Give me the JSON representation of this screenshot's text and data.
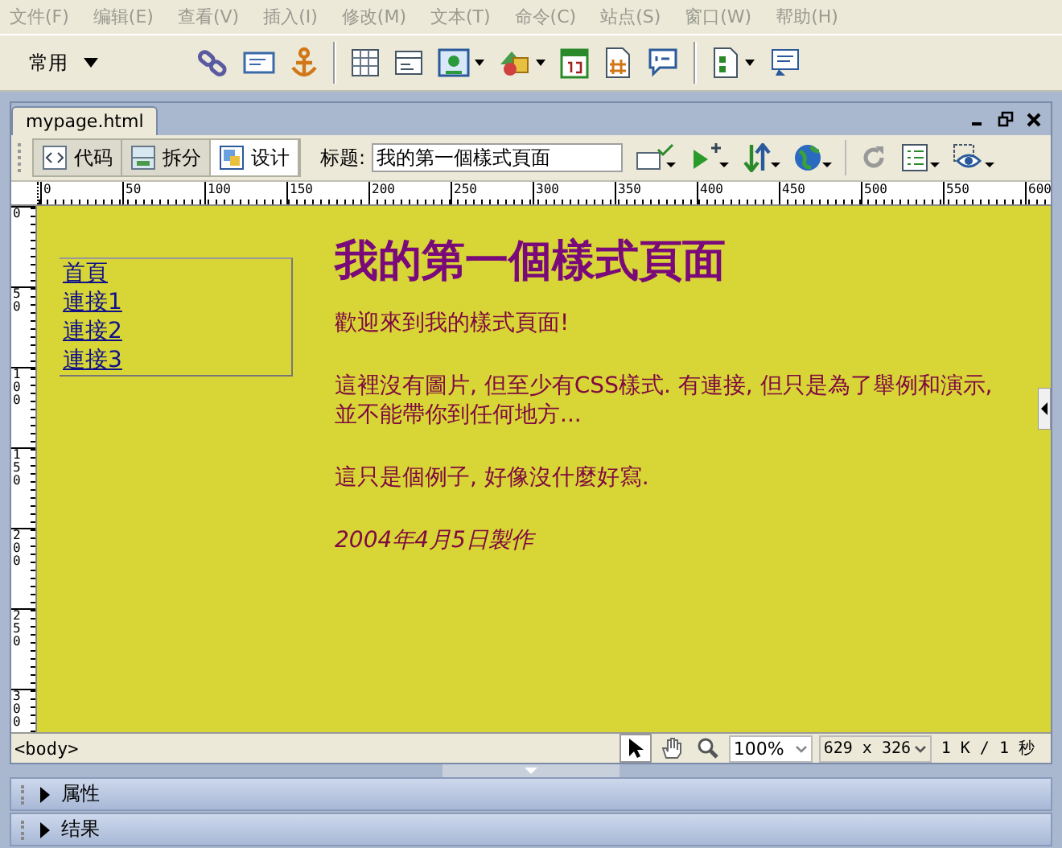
{
  "menu": [
    {
      "label": "文件(F)",
      "disabled": true
    },
    {
      "label": "编辑(E)",
      "disabled": true
    },
    {
      "label": "查看(V)",
      "disabled": true
    },
    {
      "label": "插入(I)",
      "disabled": true
    },
    {
      "label": "修改(M)",
      "disabled": true
    },
    {
      "label": "文本(T)",
      "disabled": true
    },
    {
      "label": "命令(C)",
      "disabled": true
    },
    {
      "label": "站点(S)",
      "disabled": true
    },
    {
      "label": "窗口(W)",
      "disabled": true
    },
    {
      "label": "帮助(H)",
      "disabled": true
    }
  ],
  "insert_bar": {
    "category": "常用"
  },
  "document": {
    "tab": "mypage.html",
    "views": [
      {
        "label": "代码",
        "kind": "code",
        "selected": false
      },
      {
        "label": "拆分",
        "kind": "split",
        "selected": false
      },
      {
        "label": "设计",
        "kind": "design",
        "selected": true
      }
    ],
    "title_label": "标题:",
    "title_value": "我的第一個樣式頁面",
    "ruler_h": [
      "0",
      "50",
      "100",
      "150",
      "200",
      "250",
      "300",
      "350",
      "400",
      "450",
      "500",
      "550",
      "600"
    ],
    "ruler_v": [
      "0",
      "50",
      "100",
      "150",
      "200",
      "250",
      "300"
    ],
    "page": {
      "nav": [
        "首頁",
        "連接1",
        "連接2",
        "連接3"
      ],
      "heading": "我的第一個樣式頁面",
      "paragraphs": [
        {
          "text": "歡迎來到我的樣式頁面!",
          "italic": false
        },
        {
          "text": "這裡沒有圖片, 但至少有CSS樣式. 有連接, 但只是為了舉例和演示, 並不能帶你到任何地方...",
          "italic": false
        },
        {
          "text": "這只是個例子, 好像沒什麼好寫.",
          "italic": false
        },
        {
          "text": "2004年4月5日製作",
          "italic": true
        }
      ]
    },
    "status": {
      "tag": "<body>",
      "tools": [
        {
          "kind": "pointer",
          "selected": true
        },
        {
          "kind": "hand",
          "selected": false
        },
        {
          "kind": "zoom",
          "selected": false
        }
      ],
      "zoom": "100%",
      "size": "629 x 326",
      "download": "1 K / 1 秒"
    }
  },
  "panels": [
    {
      "label": "属性",
      "expanded": false
    },
    {
      "label": "结果",
      "expanded": false
    }
  ]
}
